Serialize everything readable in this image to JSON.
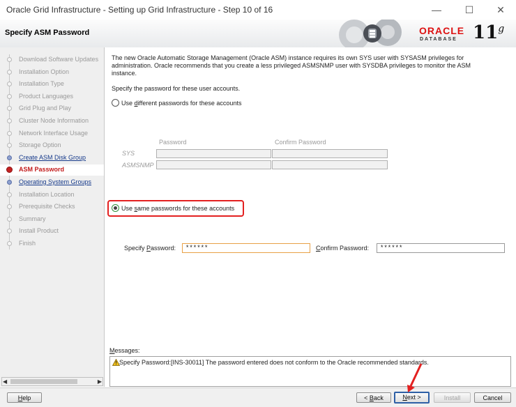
{
  "window": {
    "title": "Oracle Grid Infrastructure - Setting up Grid Infrastructure - Step 10 of 16",
    "minimize_icon": "minimize-icon",
    "maximize_icon": "maximize-icon",
    "close_icon": "close-icon"
  },
  "header": {
    "heading": "Specify ASM Password",
    "brand_oracle": "ORACLE",
    "brand_database": "DATABASE",
    "brand_version": "11",
    "brand_version_suffix": "g"
  },
  "nav": {
    "items": [
      {
        "label": "Download Software Updates",
        "state": "done"
      },
      {
        "label": "Installation Option",
        "state": "done"
      },
      {
        "label": "Installation Type",
        "state": "done"
      },
      {
        "label": "Product Languages",
        "state": "done"
      },
      {
        "label": "Grid Plug and Play",
        "state": "done"
      },
      {
        "label": "Cluster Node Information",
        "state": "done"
      },
      {
        "label": "Network Interface Usage",
        "state": "done"
      },
      {
        "label": "Storage Option",
        "state": "done"
      },
      {
        "label": "Create ASM Disk Group",
        "state": "link"
      },
      {
        "label": "ASM Password",
        "state": "current"
      },
      {
        "label": "Operating System Groups",
        "state": "link"
      },
      {
        "label": "Installation Location",
        "state": "pending"
      },
      {
        "label": "Prerequisite Checks",
        "state": "pending"
      },
      {
        "label": "Summary",
        "state": "pending"
      },
      {
        "label": "Install Product",
        "state": "pending"
      },
      {
        "label": "Finish",
        "state": "pending"
      }
    ]
  },
  "content": {
    "intro": [
      "The new Oracle Automatic Storage Management (Oracle ASM) instance requires its own SYS user with SYSASM privileges for",
      "administration. Oracle recommends that you create a less privileged ASMSNMP user with SYSDBA privileges to monitor the ASM",
      "instance."
    ],
    "specify_prompt": "Specify the password for these user accounts.",
    "radio_different": {
      "pre": "Use ",
      "key": "d",
      "post": "ifferent passwords for these accounts",
      "checked": false
    },
    "grid_headers": {
      "password": "Password",
      "confirm": "Confirm Password"
    },
    "grid_rows": [
      "SYS",
      "ASMSNMP"
    ],
    "radio_same": {
      "pre": "Use ",
      "key": "s",
      "post": "ame passwords for these accounts",
      "checked": true
    },
    "specify_password": {
      "pre": "Specify ",
      "key": "P",
      "post": "assword:",
      "value": "******"
    },
    "confirm_password": {
      "pre": "",
      "key": "C",
      "post": "onfirm Password:",
      "value": "******"
    },
    "messages_label": {
      "key": "M",
      "post": "essages:"
    },
    "message": "Specify Password:[INS-30011] The  password entered does not conform to the Oracle recommended standards.",
    "warning_icon": "warning-icon"
  },
  "buttons": {
    "help": {
      "key": "H",
      "post": "elp"
    },
    "back": {
      "pre": "< ",
      "key": "B",
      "post": "ack"
    },
    "next": {
      "key": "N",
      "post": "ext >"
    },
    "install": "Install",
    "cancel": "Cancel"
  },
  "colors": {
    "current_step": "#c21a1a",
    "link_step": "#15398a",
    "annotation_red": "#e32020",
    "focused_field": "#e8a045",
    "oracle_red": "#d11111"
  }
}
